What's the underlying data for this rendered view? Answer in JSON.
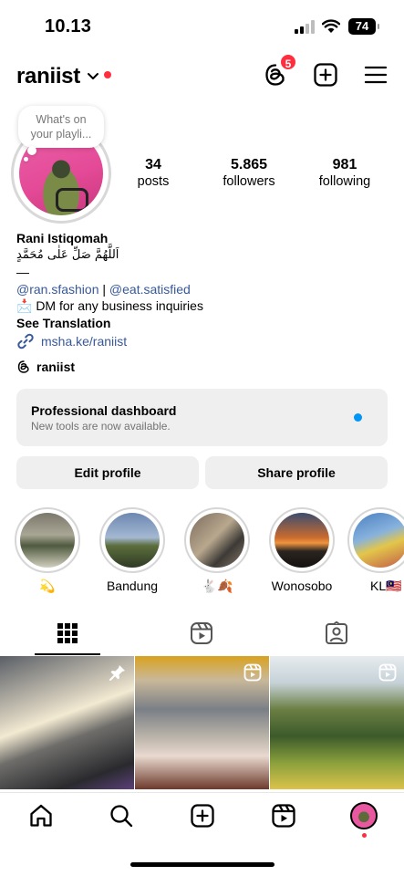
{
  "status_bar": {
    "time": "10.13",
    "battery": "74"
  },
  "header": {
    "username": "raniist",
    "threads_badge": "5",
    "icons": [
      "chevron-down-icon",
      "threads-icon",
      "add-icon",
      "menu-icon"
    ]
  },
  "note": {
    "text": "What's on your playli..."
  },
  "stats": {
    "posts": {
      "value": "34",
      "label": "posts"
    },
    "followers": {
      "value": "5.865",
      "label": "followers"
    },
    "following": {
      "value": "981",
      "label": "following"
    }
  },
  "bio": {
    "name": "Rani Istiqomah",
    "arabic": "اَللَّهُمَّ صَلِّ عَلٰى مُحَمَّدٍ",
    "dash": "—",
    "link1": "@ran.sfashion",
    "separator": " | ",
    "link2": "@eat.satisfied",
    "dm_line": "📩 DM for any business inquiries",
    "see_translation": "See Translation",
    "url": "msha.ke/raniist",
    "threads_handle": "raniist"
  },
  "dashboard": {
    "title": "Professional dashboard",
    "subtitle": "New tools are now available."
  },
  "buttons": {
    "edit": "Edit profile",
    "share": "Share profile"
  },
  "highlights": [
    {
      "label": "💫"
    },
    {
      "label": "Bandung"
    },
    {
      "label": "🐇🍂"
    },
    {
      "label": "Wonosobo"
    },
    {
      "label": "KL🇲🇾"
    }
  ],
  "tabs": [
    "grid-icon",
    "reels-icon",
    "tagged-icon"
  ],
  "bottom_nav": [
    "home-icon",
    "search-icon",
    "create-icon",
    "reels-icon",
    "profile-avatar"
  ]
}
